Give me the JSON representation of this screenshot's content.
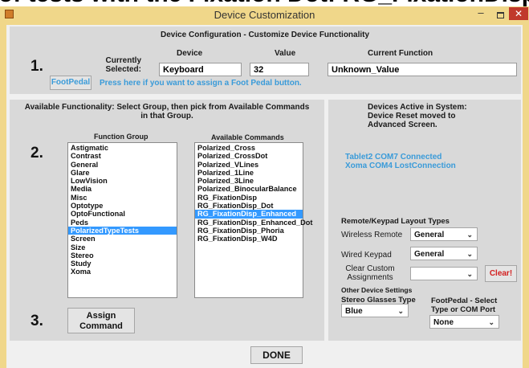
{
  "window": {
    "partial_header": "of tests with the Fixation Dot: RG_FixationDisp",
    "title": "Device Customization",
    "minimize": "–",
    "close": "✕"
  },
  "config": {
    "heading": "Device Configuration - Customize Device Functionality",
    "step": "1.",
    "currently_selected": "Currently\nSelected:",
    "col_device": "Device",
    "col_value": "Value",
    "col_function": "Current Function",
    "device_value": "Keyboard",
    "value_value": "32",
    "function_value": "Unknown_Value",
    "footpedal_button": "FootPedal",
    "footpedal_hint": "Press here if you want to assign a Foot Pedal button."
  },
  "functionality": {
    "heading": "Available Functionality: Select Group, then pick from Available Commands\nin that Group.",
    "step2": "2.",
    "step3": "3.",
    "group_label": "Function Group",
    "commands_label": "Available Commands",
    "groups": [
      "Astigmatic",
      "Contrast",
      "General",
      "Glare",
      "LowVision",
      "Media",
      "Misc",
      "Optotype",
      "OptoFunctional",
      "Peds",
      "PolarizedTypeTests",
      "Screen",
      "Size",
      "Stereo",
      "Study",
      "Xoma"
    ],
    "selected_group": "PolarizedTypeTests",
    "commands": [
      "Polarized_Cross",
      "Polarized_CrossDot",
      "Polarized_VLines",
      "Polarized_1Line",
      "Polarized_3Line",
      "Polarized_BinocularBalance",
      "RG_FixationDisp",
      "RG_FixationDisp_Dot",
      "RG_FixationDisp_Enhanced",
      "RG_FixationDisp_Enhanced_Dot",
      "RG_FixationDisp_Phoria",
      "RG_FixationDisp_W4D"
    ],
    "selected_command": "RG_FixationDisp_Enhanced",
    "assign_button": "Assign\nCommand"
  },
  "devices": {
    "heading": "Devices Active in System:\nDevice Reset moved to\nAdvanced Screen.",
    "status_lines": [
      "Tablet2 COM7 Connected",
      "Xoma COM4 LostConnection"
    ],
    "layout_heading": "Remote/Keypad Layout Types",
    "wireless_label": "Wireless Remote",
    "wireless_value": "General",
    "wired_label": "Wired Keypad",
    "wired_value": "General",
    "clear_label": "Clear Custom\nAssignments",
    "clear_value": "",
    "clear_button": "Clear!",
    "other_heading": "Other Device Settings",
    "stereo_label": "Stereo Glasses Type",
    "stereo_value": "Blue",
    "footpedal_label": "FootPedal - Select\nType or COM Port",
    "footpedal_value": "None"
  },
  "done_button": "DONE",
  "colors": {
    "title_bar": "#f0d78a",
    "selection": "#3399ff",
    "link": "#3a9bd9",
    "clear": "#d32020",
    "close": "#c0392b"
  }
}
